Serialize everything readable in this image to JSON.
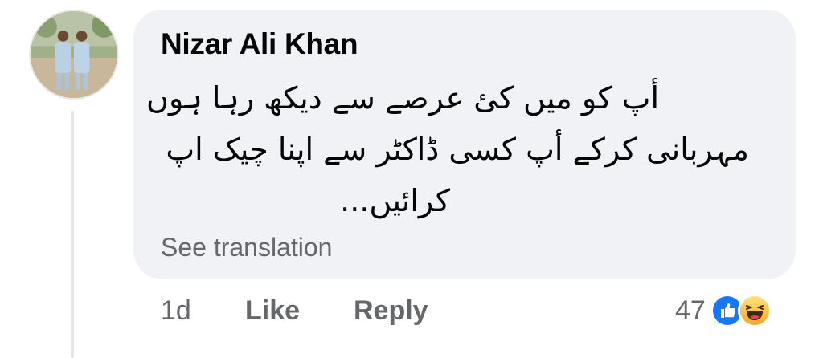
{
  "comment": {
    "author": "Nizar Ali Khan",
    "body_lines": [
      "أپ کو میں کئ عرصے سے دیکھ رہا ہوں",
      "مہربانی کرکے أپ کسی ڈاکٹر سے اپنا چیک اپ",
      "کرائیں..."
    ],
    "see_translation": "See translation",
    "time": "1d",
    "like_label": "Like",
    "reply_label": "Reply",
    "reaction_count": "47",
    "reactions": [
      "like-icon",
      "haha-icon"
    ]
  },
  "colors": {
    "bubble": "#f0f2f5",
    "like_blue": "#1877f2",
    "haha_yellow": "#f7b125",
    "meta_gray": "#65676b"
  }
}
